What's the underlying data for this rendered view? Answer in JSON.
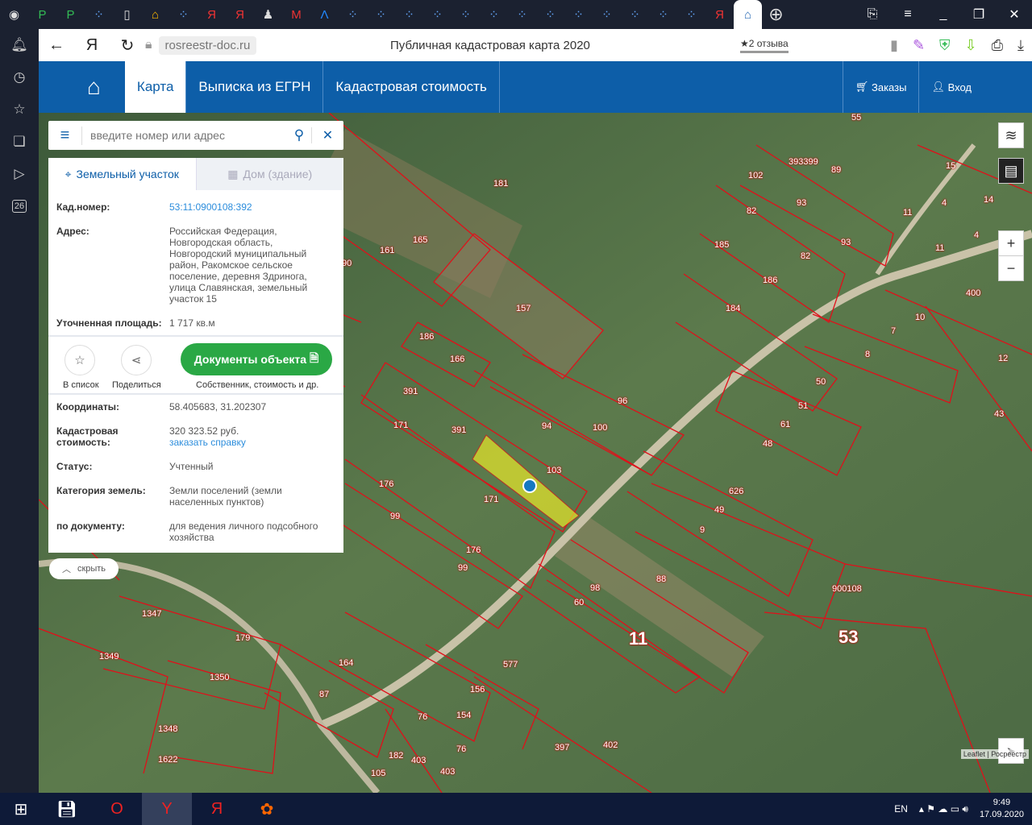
{
  "browser": {
    "url": "rosreestr-doc.ru",
    "page_title": "Публичная кадастровая карта 2020",
    "reviews": "★2 отзыва",
    "left_badge": "26"
  },
  "nav": {
    "items": [
      "Карта",
      "Выписка из ЕГРН",
      "Кадастровая стоимость"
    ],
    "orders": "Заказы",
    "login": "Вход"
  },
  "search": {
    "placeholder": "введите номер или адрес",
    "value": ""
  },
  "panel": {
    "tabs": [
      "Земельный участок",
      "Дом (здание)"
    ],
    "fields1": [
      {
        "k": "Кад.номер:",
        "v": "53:11:0900108:392"
      },
      {
        "k": "Адрес:",
        "v": "Российская Федерация, Новгородская область, Новгородский муниципальный район, Ракомское сельское поселение, деревня Здринога, улица Славянская, земельный участок 15"
      },
      {
        "k": "Уточненная площадь:",
        "v": "1 717 кв.м"
      }
    ],
    "add_list": "В список",
    "share": "Поделиться",
    "docs_button": "Документы объекта",
    "docs_sub": "Собственник, стоимость и др.",
    "coords": {
      "k": "Координаты:",
      "v": "58.405683, 31.202307"
    },
    "cost": {
      "k": "Кадастровая стоимость:",
      "v": "320 323.52 руб.",
      "link": "заказать справку"
    },
    "status": {
      "k": "Статус:",
      "v": "Учтенный"
    },
    "category": {
      "k": "Категория земель:",
      "v": "Земли поселений (земли населенных пунктов)"
    },
    "doc": {
      "k": "по документу:",
      "v": "для ведения личного подсобного хозяйства"
    },
    "hide": "скрыть"
  },
  "map": {
    "labels": [
      "55",
      "393399",
      "89",
      "102",
      "15",
      "14",
      "82",
      "93",
      "11",
      "4",
      "185",
      "93",
      "82",
      "186",
      "11",
      "4",
      "161",
      "165",
      "157",
      "184",
      "400",
      "7",
      "10",
      "8",
      "12",
      "186",
      "166",
      "391",
      "391",
      "96",
      "94",
      "100",
      "50",
      "51",
      "61",
      "48",
      "43",
      "171",
      "103",
      "171",
      "176",
      "99",
      "626",
      "49",
      "9",
      "176",
      "99",
      "98",
      "60",
      "88",
      "11",
      "900108",
      "53",
      "1347",
      "179",
      "1349",
      "1350",
      "164",
      "87",
      "577",
      "156",
      "154",
      "76",
      "1348",
      "1622",
      "182",
      "403",
      "76",
      "397",
      "402",
      "105",
      "403",
      "90",
      "181"
    ],
    "attribution": "Leaflet | Росреестр"
  },
  "taskbar": {
    "lang": "EN",
    "time": "9:49",
    "date": "17.09.2020"
  }
}
